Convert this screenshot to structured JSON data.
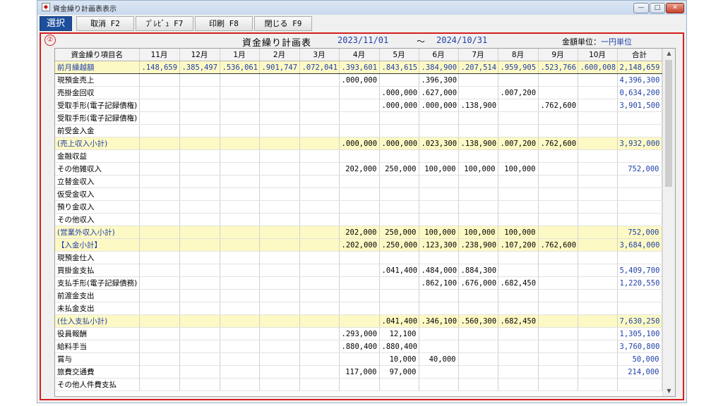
{
  "window": {
    "title": "資金繰り計画表表示",
    "controls": {
      "minimize": "—",
      "maximize": "□",
      "close": "✕"
    }
  },
  "toolbar": {
    "select": "選択",
    "cancel": "取消 F2",
    "preview": "ﾌﾟﾚﾋﾞｭ F7",
    "print": "印刷 F8",
    "close": "閉じる F9"
  },
  "marker": "②",
  "header": {
    "title": "資金繰り計画表",
    "date_from": "2023/11/01",
    "tilde": "～",
    "date_to": "2024/10/31",
    "unit_label": "金額単位：",
    "unit_value": "一円単位"
  },
  "columns": [
    "資金繰り項目名",
    "11月",
    "12月",
    "1月",
    "2月",
    "3月",
    "4月",
    "5月",
    "6月",
    "7月",
    "8月",
    "9月",
    "10月",
    "合計"
  ],
  "rows": [
    {
      "type": "carry",
      "cells": [
        "前月繰越額",
        ".148,659",
        ".385,497",
        ".536,061",
        ".901,747",
        ".072,041",
        ".393,601",
        ".843,615",
        ".384,900",
        ".207,514",
        ".959,905",
        ".523,766",
        ".600,008",
        "2,148,659"
      ]
    },
    {
      "type": "normal",
      "cells": [
        "現預金売上",
        "",
        "",
        "",
        "",
        "",
        ".000,000",
        "",
        ".396,300",
        "",
        "",
        "",
        "",
        "4,396,300"
      ]
    },
    {
      "type": "normal",
      "cells": [
        "売掛金回収",
        "",
        "",
        "",
        "",
        "",
        "",
        ".000,000",
        ".627,000",
        "",
        ".007,200",
        "",
        "",
        "0,634,200"
      ]
    },
    {
      "type": "normal",
      "cells": [
        "受取手形(電子記録債権)",
        "",
        "",
        "",
        "",
        "",
        "",
        ".000,000",
        ".000,000",
        ".138,900",
        "",
        ".762,600",
        "",
        "3,901,500"
      ]
    },
    {
      "type": "normal",
      "cells": [
        "受取手形(電子記録債権)",
        "",
        "",
        "",
        "",
        "",
        "",
        "",
        "",
        "",
        "",
        "",
        "",
        ""
      ]
    },
    {
      "type": "normal",
      "cells": [
        "前受金入金",
        "",
        "",
        "",
        "",
        "",
        "",
        "",
        "",
        "",
        "",
        "",
        "",
        ""
      ]
    },
    {
      "type": "sub",
      "cells": [
        "(売上収入小計)",
        "",
        "",
        "",
        "",
        "",
        ".000,000",
        ".000,000",
        ".023,300",
        ".138,900",
        ".007,200",
        ".762,600",
        "",
        "3,932,000"
      ]
    },
    {
      "type": "normal",
      "cells": [
        "金融収益",
        "",
        "",
        "",
        "",
        "",
        "",
        "",
        "",
        "",
        "",
        "",
        "",
        ""
      ]
    },
    {
      "type": "normal",
      "cells": [
        "その他雑収入",
        "",
        "",
        "",
        "",
        "",
        "202,000",
        "250,000",
        "100,000",
        "100,000",
        "100,000",
        "",
        "",
        "752,000"
      ]
    },
    {
      "type": "normal",
      "cells": [
        "立替金収入",
        "",
        "",
        "",
        "",
        "",
        "",
        "",
        "",
        "",
        "",
        "",
        "",
        ""
      ]
    },
    {
      "type": "normal",
      "cells": [
        "仮受金収入",
        "",
        "",
        "",
        "",
        "",
        "",
        "",
        "",
        "",
        "",
        "",
        "",
        ""
      ]
    },
    {
      "type": "normal",
      "cells": [
        "預り金収入",
        "",
        "",
        "",
        "",
        "",
        "",
        "",
        "",
        "",
        "",
        "",
        "",
        ""
      ]
    },
    {
      "type": "normal",
      "cells": [
        "その他収入",
        "",
        "",
        "",
        "",
        "",
        "",
        "",
        "",
        "",
        "",
        "",
        "",
        ""
      ]
    },
    {
      "type": "sub",
      "cells": [
        "(営業外収入小計)",
        "",
        "",
        "",
        "",
        "",
        "202,000",
        "250,000",
        "100,000",
        "100,000",
        "100,000",
        "",
        "",
        "752,000"
      ]
    },
    {
      "type": "sub",
      "cells": [
        "【入金小計】",
        "",
        "",
        "",
        "",
        "",
        ".202,000",
        ".250,000",
        ".123,300",
        ".238,900",
        ".107,200",
        ".762,600",
        "",
        "3,684,000"
      ]
    },
    {
      "type": "normal",
      "cells": [
        "現預金仕入",
        "",
        "",
        "",
        "",
        "",
        "",
        "",
        "",
        "",
        "",
        "",
        "",
        ""
      ]
    },
    {
      "type": "normal",
      "cells": [
        "買掛金支払",
        "",
        "",
        "",
        "",
        "",
        "",
        ".041,400",
        ".484,000",
        ".884,300",
        "",
        "",
        "",
        "5,409,700"
      ]
    },
    {
      "type": "normal",
      "cells": [
        "支払手形(電子記録債務)",
        "",
        "",
        "",
        "",
        "",
        "",
        "",
        ".862,100",
        ".676,000",
        ".682,450",
        "",
        "",
        "1,220,550"
      ]
    },
    {
      "type": "normal",
      "cells": [
        "前渡金支出",
        "",
        "",
        "",
        "",
        "",
        "",
        "",
        "",
        "",
        "",
        "",
        "",
        ""
      ]
    },
    {
      "type": "normal",
      "cells": [
        "未払金支出",
        "",
        "",
        "",
        "",
        "",
        "",
        "",
        "",
        "",
        "",
        "",
        "",
        ""
      ]
    },
    {
      "type": "sub",
      "cells": [
        "(仕入支払小計)",
        "",
        "",
        "",
        "",
        "",
        "",
        ".041,400",
        ".346,100",
        ".560,300",
        ".682,450",
        "",
        "",
        "7,630,250"
      ]
    },
    {
      "type": "normal",
      "cells": [
        "役員報酬",
        "",
        "",
        "",
        "",
        "",
        ".293,000",
        "12,100",
        "",
        "",
        "",
        "",
        "",
        "1,305,100"
      ]
    },
    {
      "type": "normal",
      "cells": [
        "給料手当",
        "",
        "",
        "",
        "",
        "",
        ".880,400",
        ".880,400",
        "",
        "",
        "",
        "",
        "",
        "3,760,800"
      ]
    },
    {
      "type": "normal",
      "cells": [
        "賞与",
        "",
        "",
        "",
        "",
        "",
        "",
        "10,000",
        "40,000",
        "",
        "",
        "",
        "",
        "50,000"
      ]
    },
    {
      "type": "normal",
      "cells": [
        "旅費交通費",
        "",
        "",
        "",
        "",
        "",
        "117,000",
        "97,000",
        "",
        "",
        "",
        "",
        "",
        "214,000"
      ]
    },
    {
      "type": "normal",
      "cells": [
        "その他人件費支払",
        "",
        "",
        "",
        "",
        "",
        "",
        "",
        "",
        "",
        "",
        "",
        "",
        ""
      ]
    }
  ],
  "scroll": {
    "up": "▲",
    "down": "▼"
  }
}
